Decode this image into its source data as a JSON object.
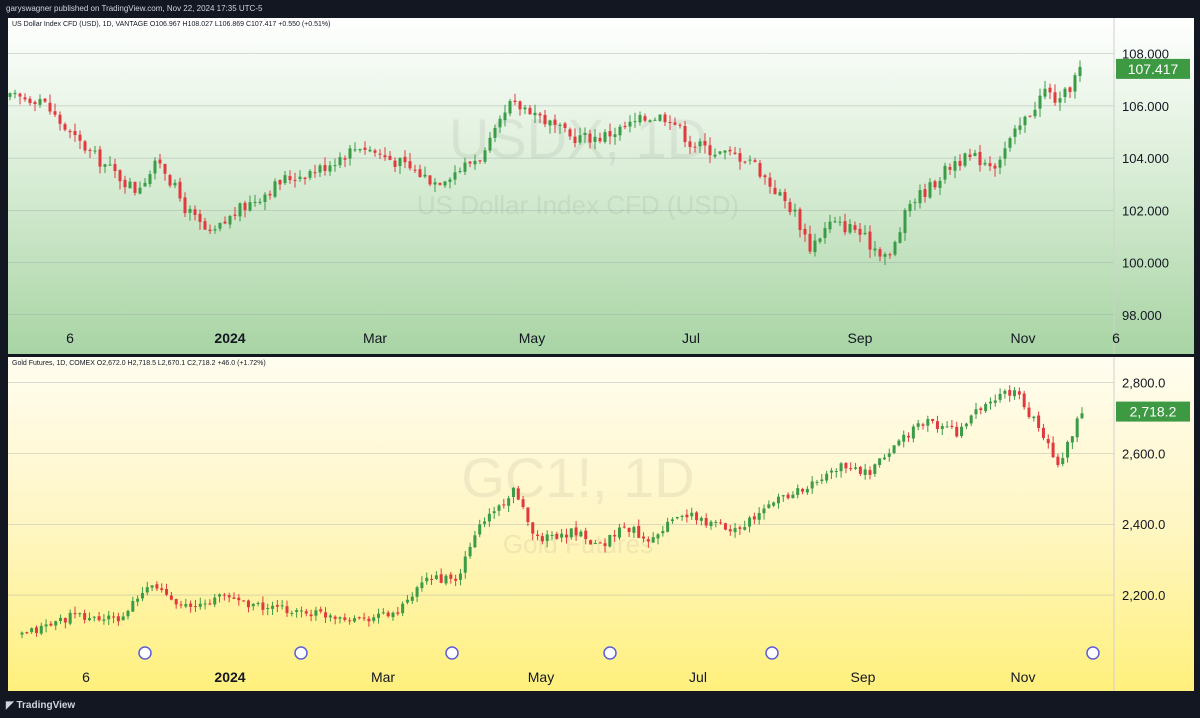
{
  "header": {
    "publisher": "garyswagner published on TradingView.com, Nov 22, 2024 17:35 UTC-5"
  },
  "footer": {
    "brand": "TradingView",
    "logo": "tradingview-logo"
  },
  "colors": {
    "up": "#26a69a",
    "up_candle": "#3a9c46",
    "down": "#e03a3e",
    "price_tag": "#3d9a42"
  },
  "chart_data": [
    {
      "type": "candlestick",
      "legend": "US Dollar Index CFD (USD), 1D, VANTAGE  O106.967  H108.027  L106.869  C107.417  +0.550 (+0.51%)",
      "watermark_symbol": "USDX, 1D",
      "watermark_name": "US Dollar Index CFD (USD)",
      "x_ticks": [
        "6",
        "2024",
        "Mar",
        "May",
        "Jul",
        "Sep",
        "Nov",
        "6"
      ],
      "y_ticks": [
        "108.000",
        "106.000",
        "104.000",
        "102.000",
        "100.000",
        "98.000"
      ],
      "ylim": [
        97.8,
        108.6
      ],
      "last_price": "107.417",
      "close_path": [
        [
          0,
          106.3
        ],
        [
          6,
          106.3
        ],
        [
          12,
          104.9
        ],
        [
          18,
          103.9
        ],
        [
          25,
          102.8
        ],
        [
          30,
          103.9
        ],
        [
          35,
          102.1
        ],
        [
          40,
          101.0
        ],
        [
          45,
          101.9
        ],
        [
          55,
          103.2
        ],
        [
          62,
          103.6
        ],
        [
          70,
          104.5
        ],
        [
          78,
          103.8
        ],
        [
          85,
          103.1
        ],
        [
          90,
          103.6
        ],
        [
          95,
          104.2
        ],
        [
          100,
          106.0
        ],
        [
          104,
          105.9
        ],
        [
          108,
          105.3
        ],
        [
          112,
          104.8
        ],
        [
          118,
          104.8
        ],
        [
          122,
          105.1
        ],
        [
          128,
          105.6
        ],
        [
          132,
          105.6
        ],
        [
          136,
          104.6
        ],
        [
          142,
          104.2
        ],
        [
          148,
          104.0
        ],
        [
          152,
          103.0
        ],
        [
          157,
          101.9
        ],
        [
          160,
          100.6
        ],
        [
          164,
          101.5
        ],
        [
          169,
          101.3
        ],
        [
          172,
          100.7
        ],
        [
          176,
          100.2
        ],
        [
          180,
          102.3
        ],
        [
          184,
          102.9
        ],
        [
          189,
          103.9
        ],
        [
          193,
          104.0
        ],
        [
          197,
          103.8
        ],
        [
          202,
          105.2
        ],
        [
          207,
          106.6
        ],
        [
          210,
          106.1
        ],
        [
          214,
          107.4
        ]
      ]
    },
    {
      "type": "candlestick",
      "legend": "Gold Futures, 1D, COMEX  O2,672.0  H2,718.5  L2,670.1  C2,718.2  +46.0 (+1.72%)",
      "watermark_symbol": "GC1!, 1D",
      "watermark_name": "Gold Futures",
      "x_ticks": [
        "6",
        "2024",
        "Mar",
        "May",
        "Jul",
        "Sep",
        "Nov"
      ],
      "y_ticks": [
        "2,800.0",
        "2,600.0",
        "2,400.0",
        "2,200.0"
      ],
      "ylim": [
        2090,
        2830
      ],
      "last_price": "2,718.2",
      "close_path": [
        [
          0,
          2085
        ],
        [
          10,
          2140
        ],
        [
          20,
          2130
        ],
        [
          27,
          2230
        ],
        [
          35,
          2160
        ],
        [
          42,
          2200
        ],
        [
          50,
          2165
        ],
        [
          60,
          2150
        ],
        [
          70,
          2135
        ],
        [
          78,
          2150
        ],
        [
          85,
          2255
        ],
        [
          90,
          2235
        ],
        [
          95,
          2400
        ],
        [
          102,
          2490
        ],
        [
          107,
          2360
        ],
        [
          115,
          2380
        ],
        [
          120,
          2340
        ],
        [
          125,
          2395
        ],
        [
          130,
          2360
        ],
        [
          137,
          2430
        ],
        [
          143,
          2400
        ],
        [
          148,
          2390
        ],
        [
          152,
          2415
        ],
        [
          157,
          2475
        ],
        [
          164,
          2510
        ],
        [
          170,
          2565
        ],
        [
          176,
          2540
        ],
        [
          182,
          2640
        ],
        [
          188,
          2690
        ],
        [
          194,
          2660
        ],
        [
          200,
          2740
        ],
        [
          206,
          2780
        ],
        [
          212,
          2650
        ],
        [
          215,
          2560
        ],
        [
          220,
          2718
        ]
      ]
    }
  ]
}
